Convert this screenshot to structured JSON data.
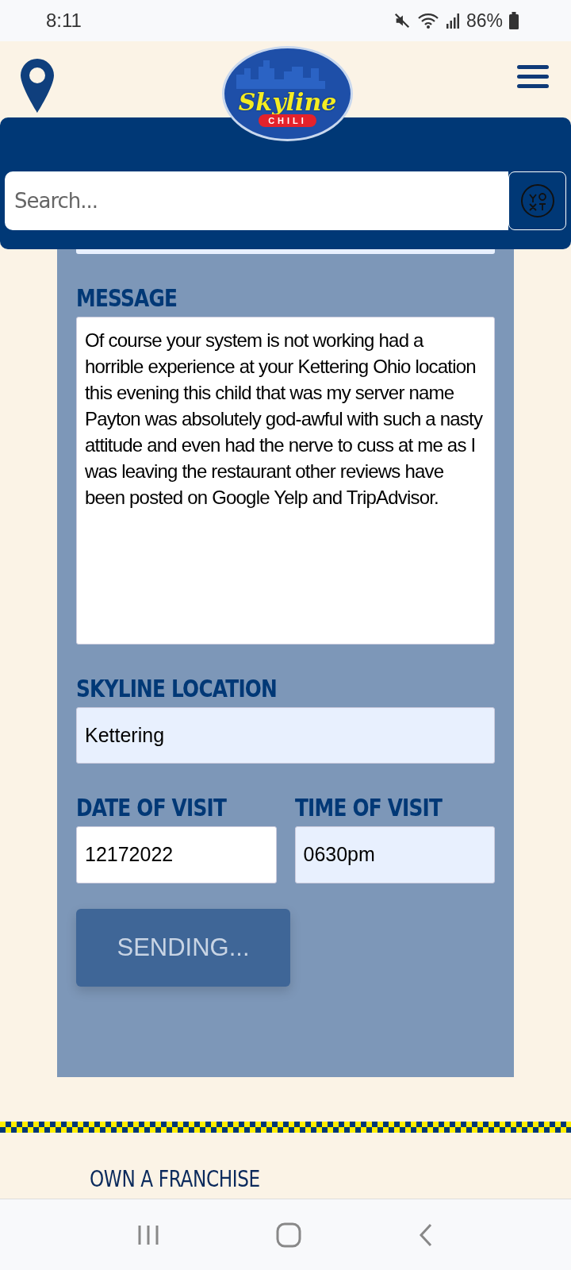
{
  "status_bar": {
    "time": "8:11",
    "battery": "86%"
  },
  "header": {
    "logo": {
      "name": "Skyline",
      "tag": "CHILI"
    },
    "search": {
      "placeholder": "Search..."
    }
  },
  "form": {
    "fields": [
      {
        "label": "MESSAGE",
        "kind": "textarea",
        "value": "Of course your system is not working had a horrible experience at your Kettering Ohio location this evening this child that was my server name Payton was absolutely god-awful with such a nasty attitude and even had the nerve to cuss at me as I was leaving the restaurant other reviews have been posted on Google Yelp and TripAdvisor.",
        "autofilled": false
      },
      {
        "label": "SKYLINE LOCATION",
        "kind": "text",
        "value": "Kettering",
        "autofilled": true
      }
    ],
    "pair": [
      {
        "label": "DATE OF VISIT",
        "value": "12172022",
        "autofilled": false
      },
      {
        "label": "TIME OF VISIT",
        "value": "0630pm",
        "autofilled": true
      }
    ],
    "submit": {
      "label": "SENDING...",
      "disabled": true
    }
  },
  "footer": {
    "link": "OWN A FRANCHISE"
  }
}
